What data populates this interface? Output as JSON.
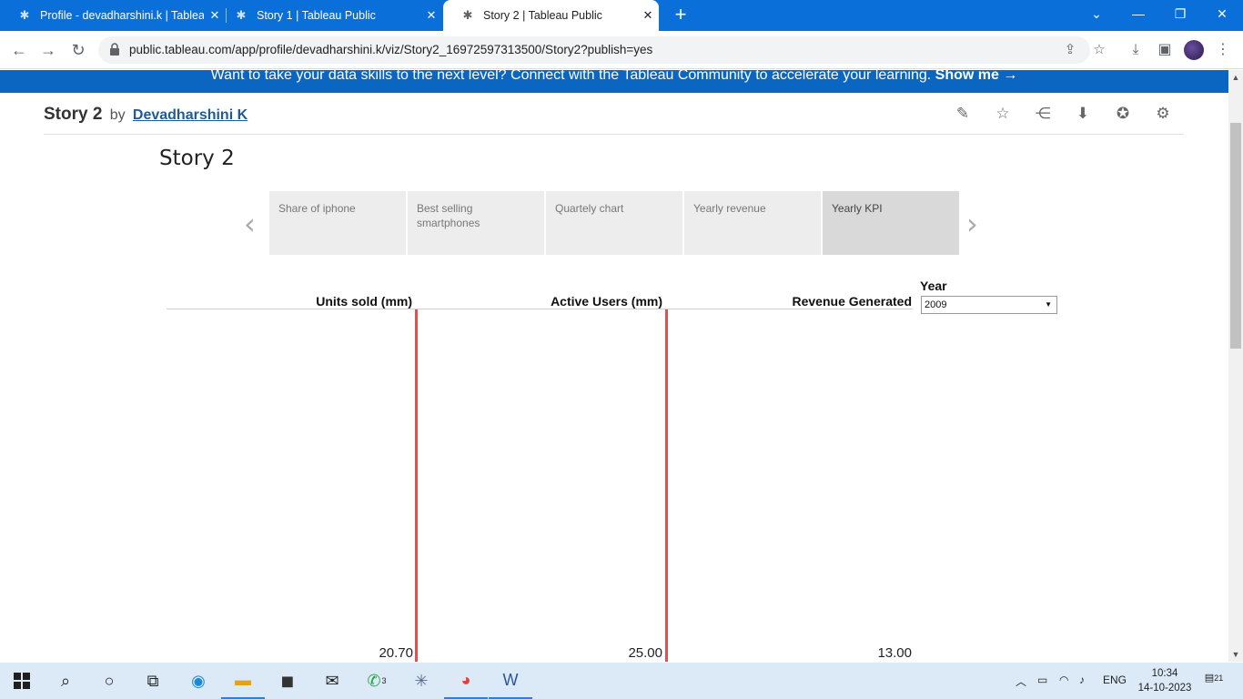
{
  "browser": {
    "tabs": [
      {
        "title": "Profile - devadharshini.k | Tablea",
        "active": false
      },
      {
        "title": "Story 1 | Tableau Public",
        "active": false
      },
      {
        "title": "Story 2 | Tableau Public",
        "active": true
      }
    ],
    "url": "public.tableau.com/app/profile/devadharshini.k/viz/Story2_16972597313500/Story2?publish=yes"
  },
  "banner": {
    "text": "Want to take your data skills to the next level? Connect with the Tableau Community to accelerate your learning.",
    "cta": "Show me →"
  },
  "viz": {
    "title": "Story 2",
    "by": "by",
    "author": "Devadharshini K"
  },
  "story": {
    "title": "Story 2",
    "points": [
      {
        "label": "Share of iphone",
        "active": false
      },
      {
        "label": "Best selling smartphones",
        "active": false
      },
      {
        "label": "Quartely chart",
        "active": false
      },
      {
        "label": "Yearly revenue",
        "active": false
      },
      {
        "label": "Yearly KPI",
        "active": true
      }
    ],
    "columns": [
      {
        "header": "Units sold (mm)",
        "value": "20.70"
      },
      {
        "header": "Active Users (mm)",
        "value": "25.00"
      },
      {
        "header": "Revenue Generated",
        "value": "13.00"
      }
    ],
    "filter": {
      "label": "Year",
      "value": "2009"
    },
    "colors": {
      "refline": "#d9534f",
      "active_point": "#d9d9d9",
      "inactive_point": "#ededed"
    }
  },
  "taskbar": {
    "whatsapp_badge": "3",
    "tray_lang": "ENG",
    "time": "10:34",
    "date": "14-10-2023",
    "notifications": "21"
  }
}
